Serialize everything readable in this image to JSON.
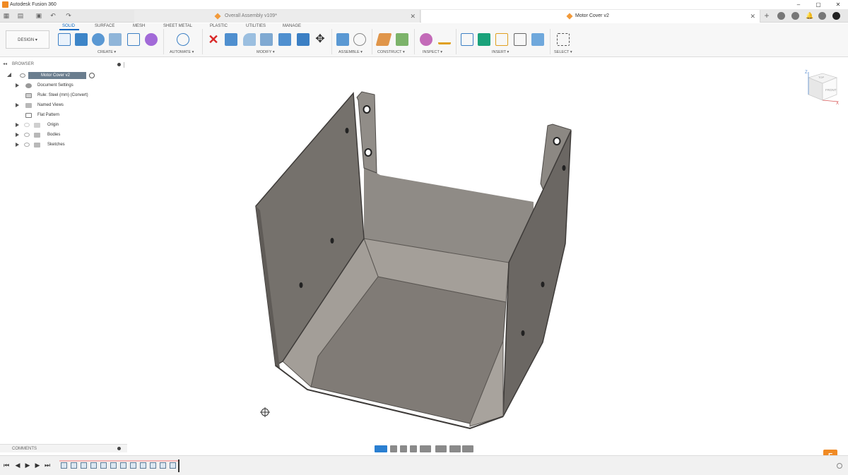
{
  "app": {
    "title": "Autodesk Fusion 360"
  },
  "tabs": [
    {
      "label": "Overall Assembly v109*",
      "active": false
    },
    {
      "label": "Motor Cover v2",
      "active": true
    }
  ],
  "ribbon": {
    "workspace": "DESIGN ▾",
    "tabs": [
      "SOLID",
      "SURFACE",
      "MESH",
      "SHEET METAL",
      "PLASTIC",
      "UTILITIES",
      "MANAGE"
    ],
    "active_tab": "SOLID",
    "groups": [
      "CREATE ▾",
      "AUTOMATE ▾",
      "MODIFY ▾",
      "ASSEMBLE ▾",
      "CONSTRUCT ▾",
      "INSPECT ▾",
      "INSERT ▾",
      "SELECT ▾"
    ]
  },
  "browser": {
    "header": "BROWSER",
    "root": "Motor Cover v2",
    "items": [
      {
        "label": "Document Settings",
        "icon": "gear-icon"
      },
      {
        "label": "Rule: Steel (mm) (Convert)",
        "icon": "rule-icon"
      },
      {
        "label": "Named Views",
        "icon": "folder-icon"
      },
      {
        "label": "Flat Pattern",
        "icon": "flat-pattern-icon"
      },
      {
        "label": "Origin",
        "icon": "folder-icon"
      },
      {
        "label": "Bodies",
        "icon": "folder-icon"
      },
      {
        "label": "Sketches",
        "icon": "folder-icon"
      }
    ]
  },
  "comments": {
    "label": "COMMENTS"
  },
  "viewcube": {
    "top": "TOP",
    "front": "FRONT",
    "z": "Z",
    "x": "X"
  },
  "colors": {
    "accent": "#0a66c2",
    "sheet_metal": "#8e8a84",
    "brand": "#f08a24"
  }
}
